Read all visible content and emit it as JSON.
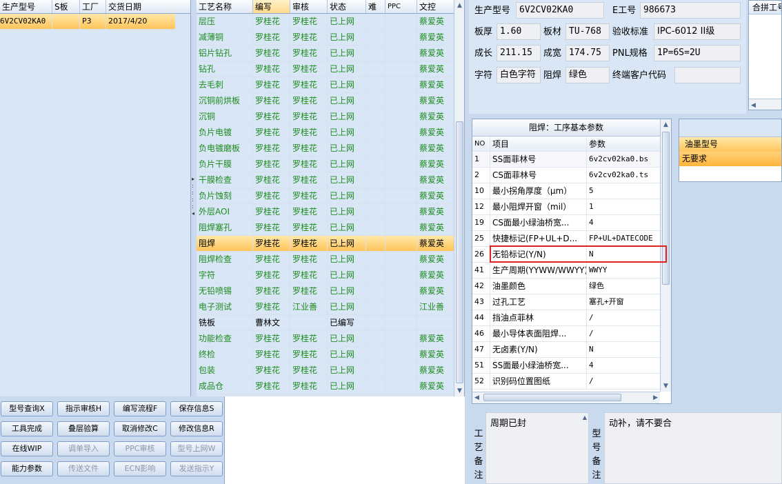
{
  "left": {
    "headers": [
      "生产型号",
      "S板",
      "工厂",
      "交货日期"
    ],
    "rows": [
      [
        "6V2CV02KA0",
        "",
        "P3",
        "2017/4/20"
      ]
    ]
  },
  "buttons": [
    [
      "型号查询X",
      "指示审核H",
      "编写流程F",
      "保存信息S"
    ],
    [
      "工具完成",
      "叠层验算",
      "取消修改C",
      "修改信息R"
    ],
    [
      "在线WIP",
      "调单导入",
      "PPC审核",
      "型号上网W"
    ],
    [
      "能力参数",
      "传送文件",
      "ECN影响",
      "发送指示Y"
    ]
  ],
  "process": {
    "headers": [
      "工艺名称",
      "编写",
      "审核",
      "状态",
      "难",
      "PPC",
      "文控"
    ],
    "rows": [
      [
        "层压",
        "罗桂花",
        "罗桂花",
        "已上网",
        "",
        "",
        "蔡爱英"
      ],
      [
        "减薄铜",
        "罗桂花",
        "罗桂花",
        "已上网",
        "",
        "",
        "蔡爱英"
      ],
      [
        "铝片钻孔",
        "罗桂花",
        "罗桂花",
        "已上网",
        "",
        "",
        "蔡爱英"
      ],
      [
        "钻孔",
        "罗桂花",
        "罗桂花",
        "已上网",
        "",
        "",
        "蔡爱英"
      ],
      [
        "去毛刺",
        "罗桂花",
        "罗桂花",
        "已上网",
        "",
        "",
        "蔡爱英"
      ],
      [
        "沉铜前烘板",
        "罗桂花",
        "罗桂花",
        "已上网",
        "",
        "",
        "蔡爱英"
      ],
      [
        "沉铜",
        "罗桂花",
        "罗桂花",
        "已上网",
        "",
        "",
        "蔡爱英"
      ],
      [
        "负片电镀",
        "罗桂花",
        "罗桂花",
        "已上网",
        "",
        "",
        "蔡爱英"
      ],
      [
        "负电镀磨板",
        "罗桂花",
        "罗桂花",
        "已上网",
        "",
        "",
        "蔡爱英"
      ],
      [
        "负片干膜",
        "罗桂花",
        "罗桂花",
        "已上网",
        "",
        "",
        "蔡爱英"
      ],
      [
        "干膜检查",
        "罗桂花",
        "罗桂花",
        "已上网",
        "",
        "",
        "蔡爱英"
      ],
      [
        "负片蚀刻",
        "罗桂花",
        "罗桂花",
        "已上网",
        "",
        "",
        "蔡爱英"
      ],
      [
        "外层AOI",
        "罗桂花",
        "罗桂花",
        "已上网",
        "",
        "",
        "蔡爱英"
      ],
      [
        "阻焊塞孔",
        "罗桂花",
        "罗桂花",
        "已上网",
        "",
        "",
        "蔡爱英"
      ],
      [
        "阻焊",
        "罗桂花",
        "罗桂花",
        "已上网",
        "",
        "",
        "蔡爱英"
      ],
      [
        "阻焊检查",
        "罗桂花",
        "罗桂花",
        "已上网",
        "",
        "",
        "蔡爱英"
      ],
      [
        "字符",
        "罗桂花",
        "罗桂花",
        "已上网",
        "",
        "",
        "蔡爱英"
      ],
      [
        "无铅喷锡",
        "罗桂花",
        "罗桂花",
        "已上网",
        "",
        "",
        "蔡爱英"
      ],
      [
        "电子测试",
        "罗桂花",
        "江业善",
        "已上网",
        "",
        "",
        "江业善"
      ],
      [
        "铣板",
        "曹林文",
        "",
        "已编写",
        "",
        "",
        ""
      ],
      [
        "功能检查",
        "罗桂花",
        "罗桂花",
        "已上网",
        "",
        "",
        "蔡爱英"
      ],
      [
        "终检",
        "罗桂花",
        "罗桂花",
        "已上网",
        "",
        "",
        "蔡爱英"
      ],
      [
        "包装",
        "罗桂花",
        "罗桂花",
        "已上网",
        "",
        "",
        "蔡爱英"
      ],
      [
        "成品仓",
        "罗桂花",
        "罗桂花",
        "已上网",
        "",
        "",
        "蔡爱英"
      ]
    ]
  },
  "info": {
    "model_label": "生产型号",
    "model": "6V2CV02KA0",
    "eno_label": "E工号",
    "eno": "986673",
    "thick_label": "板厚",
    "thick": "1.60",
    "mat_label": "板材",
    "mat": "TU-768",
    "std_label": "验收标准",
    "std": "IPC-6012 II级",
    "len_label": "成长",
    "len": "211.15",
    "wid_label": "成宽",
    "wid": "174.75",
    "pnl_label": "PNL规格",
    "pnl": "1P=6S=2U",
    "char_label": "字符",
    "char": "白色字符",
    "mask_label": "阻焊",
    "mask": "绿色",
    "cust_label": "终端客户代码",
    "cust": ""
  },
  "combine_label": "合拼工号",
  "params": {
    "title": "阻焊：工序基本参数",
    "headers": [
      "NO",
      "项目",
      "参数"
    ],
    "rows": [
      [
        "1",
        "SS面菲林号",
        "6v2cv02ka0.bs"
      ],
      [
        "2",
        "CS面菲林号",
        "6v2cv02ka0.ts"
      ],
      [
        "10",
        "最小拐角厚度（μm）",
        "5"
      ],
      [
        "12",
        "最小阻焊开窗（mil）",
        "1"
      ],
      [
        "19",
        "CS面最小绿油桥宽...",
        "4"
      ],
      [
        "25",
        "快捷标记(FP+UL+D...",
        "FP+UL+DATECODE"
      ],
      [
        "26",
        "无铅标记(Y/N)",
        "N"
      ],
      [
        "41",
        "生产周期(YYWW/WWYY)",
        "WWYY"
      ],
      [
        "42",
        "油墨颜色",
        "绿色"
      ],
      [
        "43",
        "过孔工艺",
        "塞孔+开窗"
      ],
      [
        "44",
        "挡油点菲林",
        "/"
      ],
      [
        "46",
        "最小导体表面阻焊...",
        "/"
      ],
      [
        "47",
        "无卤素(Y/N)",
        "N"
      ],
      [
        "51",
        "SS面最小绿油桥宽...",
        "4"
      ],
      [
        "52",
        "识别码位置图纸",
        "/"
      ]
    ]
  },
  "ink": {
    "header": "油墨型号",
    "value": "无要求"
  },
  "notes": {
    "process_label": "工艺备注",
    "process_text": "周期已封",
    "model_label": "型号备注",
    "model_text": "动补，请不要合"
  }
}
